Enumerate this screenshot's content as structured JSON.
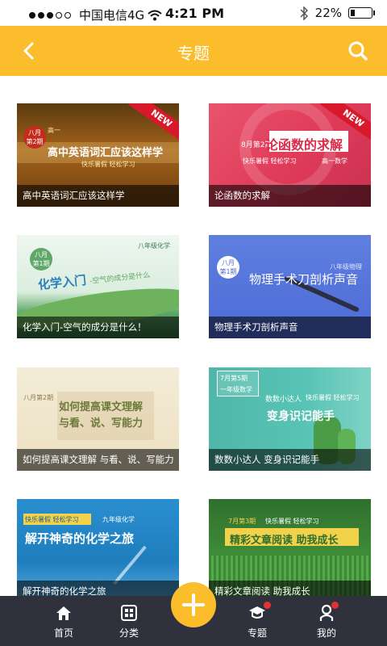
{
  "status_bar": {
    "carrier": "中国电信4G",
    "time": "4:21 PM",
    "battery": "22%",
    "battery_level": 0.22
  },
  "header": {
    "title": "专题",
    "back_icon": "chevron-left-icon",
    "search_icon": "search-icon"
  },
  "topics": [
    {
      "caption": "高中英语词汇应该这样学",
      "headline": "高中英语词汇应该这样学",
      "badge": [
        "八月",
        "第2期"
      ],
      "tag": "快乐暑假 轻松学习",
      "corner": "高一",
      "ribbon": "NEW"
    },
    {
      "caption": "论函数的求解",
      "headline": "论函数的求解",
      "badge": [
        "8月第2期"
      ],
      "tag": "快乐暑假 轻松学习",
      "corner": "高一数学",
      "ribbon": "NEW"
    },
    {
      "caption": "化学入门-空气的成分是什么！",
      "headline": "化学入门",
      "subheadline": "-空气的成分是什么",
      "badge": [
        "八月",
        "第1期"
      ],
      "corner": "八年级化学"
    },
    {
      "caption": "物理手术刀剖析声音",
      "headline": "物理手术刀剖析声音",
      "badge": [
        "八月",
        "第1期"
      ],
      "corner": "八年级物理"
    },
    {
      "caption": "如何提高课文理解 与看、说、写能力",
      "headline": "如何提高课文理解",
      "subheadline": "与看、说、写能力",
      "badge": [
        "八月第2期"
      ]
    },
    {
      "caption": "数数小达人 变身识记能手",
      "headline": "变身识记能手",
      "subheadline": "数数小达人",
      "badge": [
        "7月第5期",
        "一年级数学"
      ],
      "tag": "快乐暑假 轻松学习"
    },
    {
      "caption": "解开神奇的化学之旅",
      "headline": "解开神奇的化学之旅",
      "tag": "快乐暑假 轻松学习",
      "corner": "九年级化学"
    },
    {
      "caption": "精彩文章阅读  助我成长",
      "headline": "精彩文章阅读  助我成长",
      "tag": "快乐暑假 轻松学习",
      "badge": [
        "7月第3期"
      ]
    }
  ],
  "bottom_nav": {
    "items": [
      {
        "label": "首页",
        "icon": "home-icon"
      },
      {
        "label": "分类",
        "icon": "grid-icon"
      },
      {
        "label": "专题",
        "icon": "graduation-cap-icon",
        "badge": true
      },
      {
        "label": "我的",
        "icon": "person-icon",
        "badge": true
      }
    ],
    "fab_icon": "plus-icon"
  },
  "colors": {
    "brand": "#fbbd2b",
    "nav_bg": "#2f323c",
    "badge": "#e53131",
    "ribbon": "#d7192b"
  }
}
